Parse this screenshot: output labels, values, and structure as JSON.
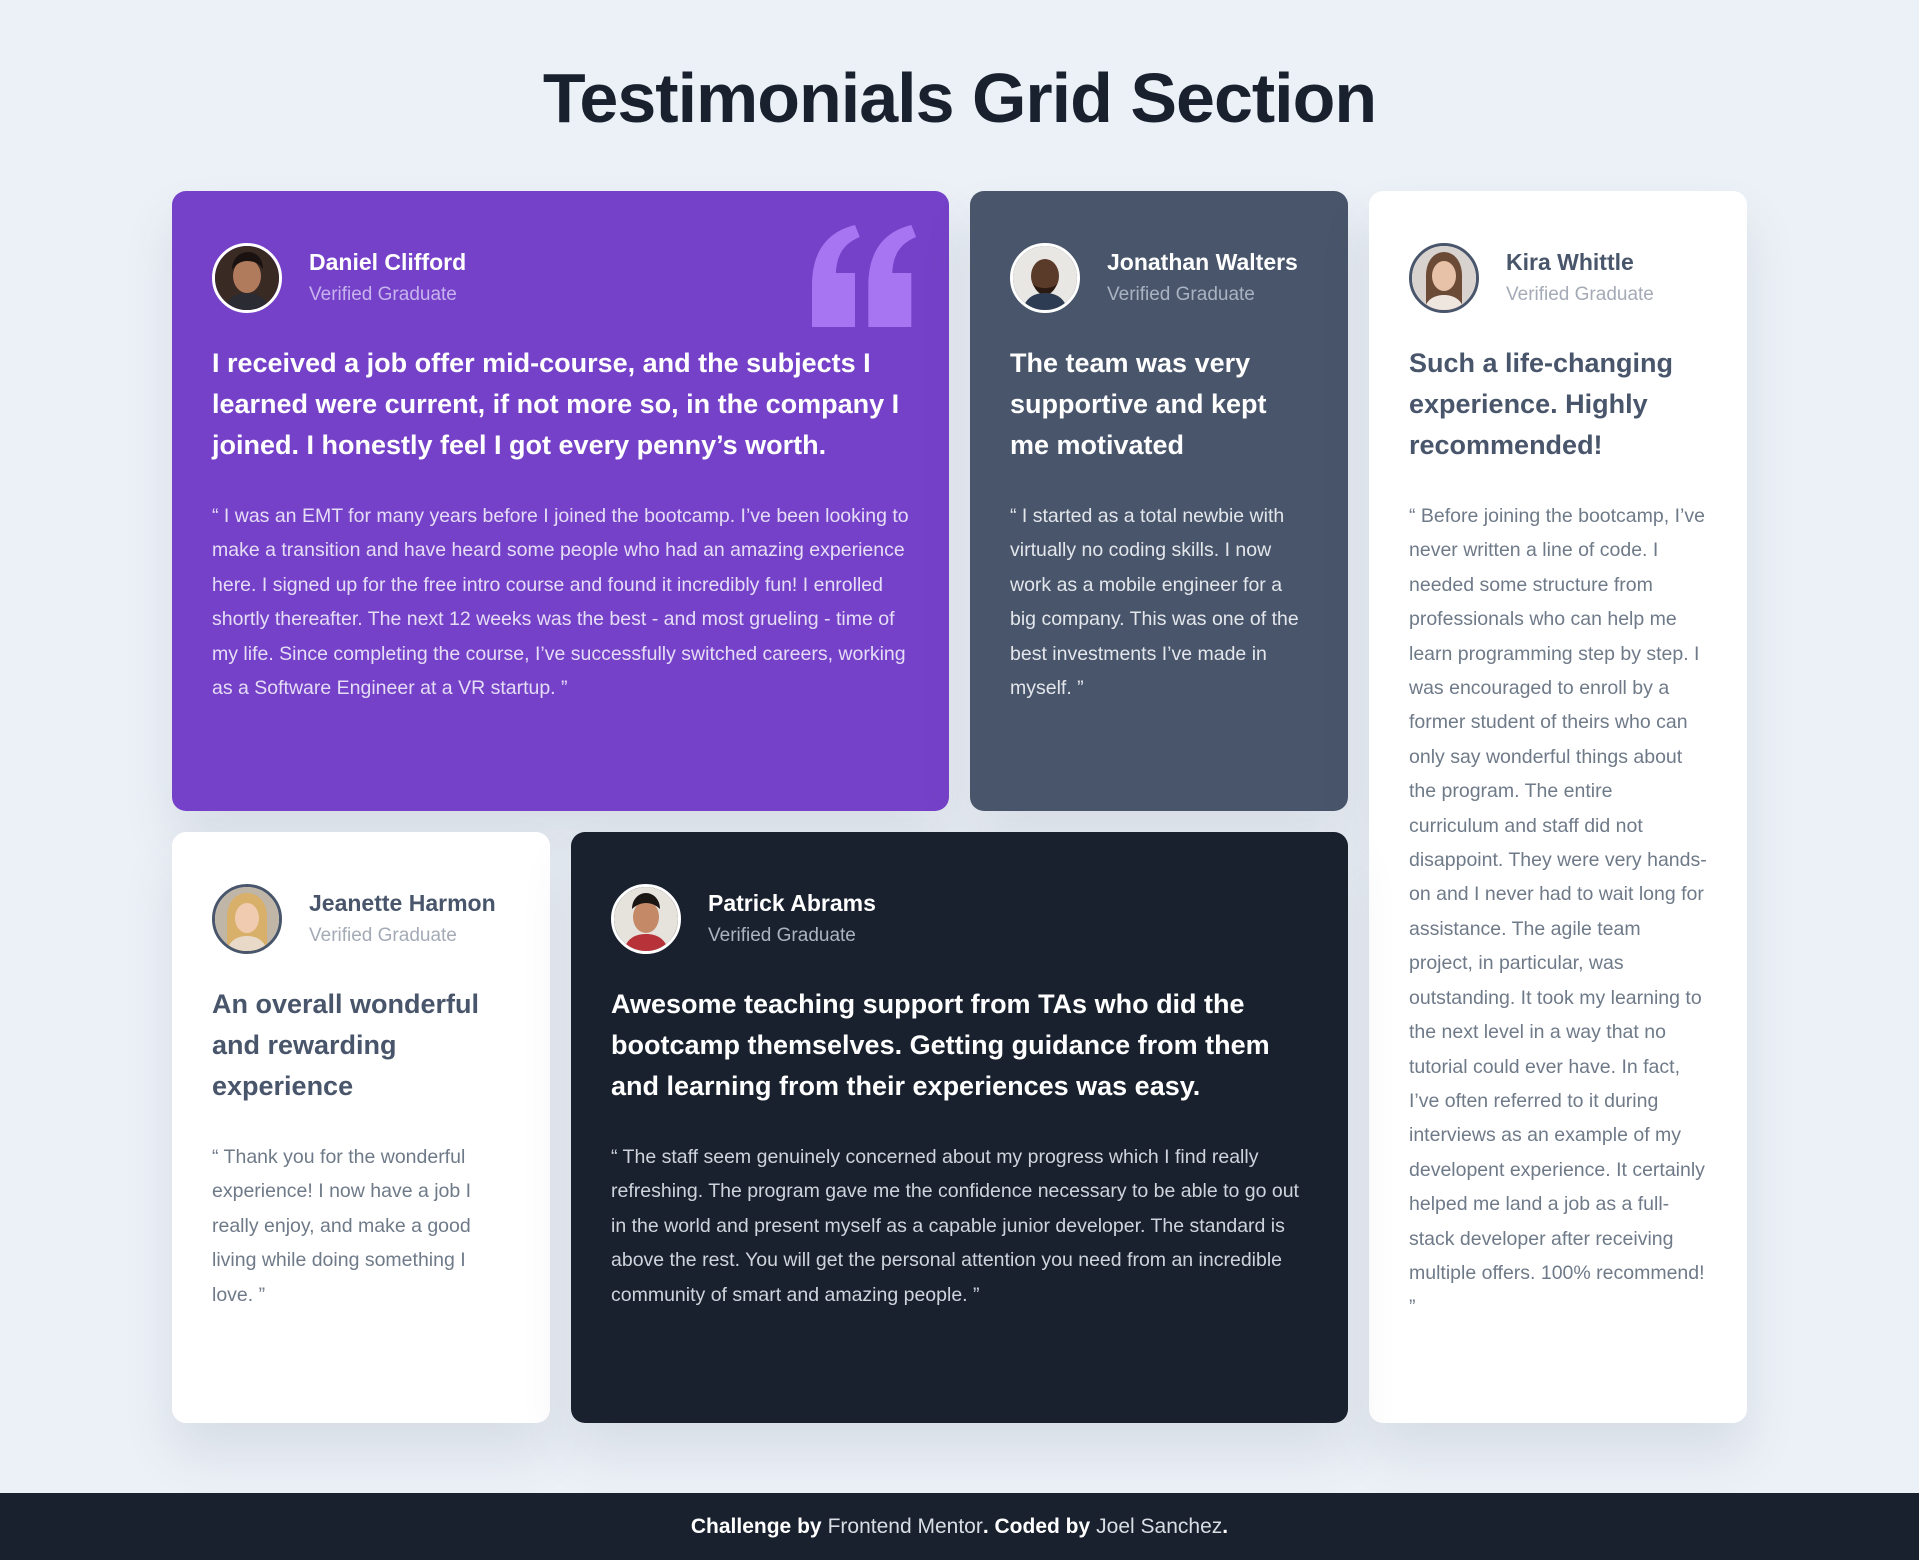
{
  "page": {
    "title": "Testimonials Grid Section"
  },
  "colors": {
    "background": "#ecf1f7",
    "purple": "#7541c8",
    "grey_blue": "#48556a",
    "dark_navy": "#19212e",
    "white": "#ffffff",
    "quote_mark": "#a775f1"
  },
  "testimonials": [
    {
      "name": "Daniel Clifford",
      "role": "Verified Graduate",
      "headline": "I received a job offer mid-course, and the subjects I learned were current, if not more so, in the company I joined. I honestly feel I got every penny’s worth.",
      "body": "“ I was an EMT for many years before I joined the bootcamp. I’ve been looking to make a transition and have heard some people who had an amazing experience here. I signed up for the free intro course and found it incredibly fun! I enrolled shortly thereafter. The next 12 weeks was the best - and most grueling - time of my life. Since completing the course, I’ve successfully switched careers, working as a Software Engineer at a VR startup. ”",
      "icon": "quotation-icon"
    },
    {
      "name": "Jonathan Walters",
      "role": "Verified Graduate",
      "headline": "The team was very supportive and kept me motivated",
      "body": "“ I started as a total newbie with virtually no coding skills. I now work as a mobile engineer for a big company. This was one of the best investments I’ve made in myself. ”"
    },
    {
      "name": "Kira Whittle",
      "role": "Verified Graduate",
      "headline": "Such a life-changing experience. Highly recommended!",
      "body": "“ Before joining the bootcamp, I’ve never written a line of code. I needed some structure from professionals who can help me learn programming step by step. I was encouraged to enroll by a former student of theirs who can only say wonderful things about the program. The entire curriculum and staff did not disappoint. They were very hands-on and I never had to wait long for assistance. The agile team project, in particular, was outstanding. It took my learning to the next level in a way that no tutorial could ever have. In fact, I’ve often referred to it during interviews as an example of my developent experience. It certainly helped me land a job as a full-stack developer after receiving multiple offers. 100% recommend! ”"
    },
    {
      "name": "Jeanette Harmon",
      "role": "Verified Graduate",
      "headline": "An overall wonderful and rewarding experience",
      "body": "“ Thank you for the wonderful experience! I now have a job I really enjoy, and make a good living while doing something I love. ”"
    },
    {
      "name": "Patrick Abrams",
      "role": "Verified Graduate",
      "headline": "Awesome teaching support from TAs who did the bootcamp themselves. Getting guidance from them and learning from their experiences was easy.",
      "body": "“ The staff seem genuinely concerned about my progress which I find really refreshing. The program gave me the confidence necessary to be able to go out in the world and present myself as a capable junior developer. The standard is above the rest. You will get the personal attention you need from an incredible community of smart and amazing people. ”"
    }
  ],
  "footer": {
    "prefix": "Challenge by",
    "link1": "Frontend Mentor",
    "middle": ". Coded by",
    "link2": "Joel Sanchez",
    "suffix": "."
  }
}
